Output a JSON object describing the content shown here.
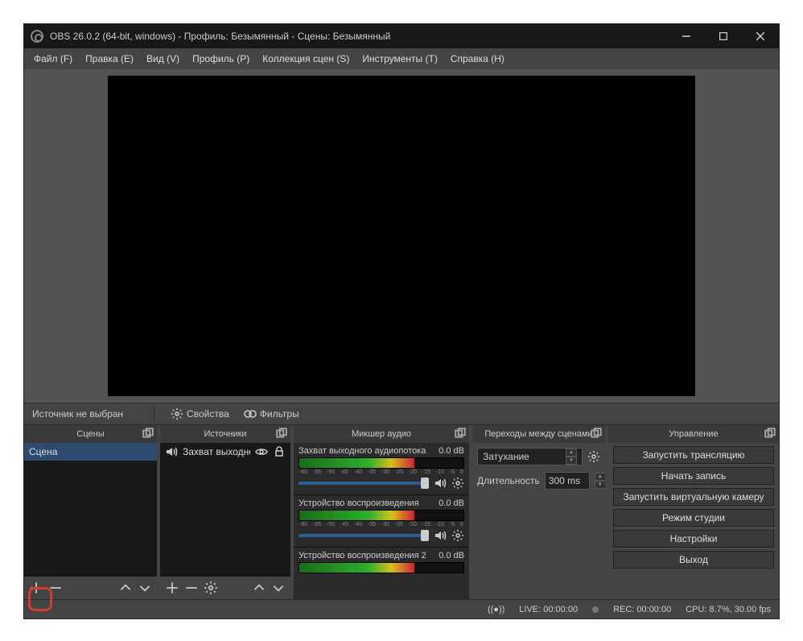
{
  "title": "OBS 26.0.2 (64-bit, windows) - Профиль: Безымянный - Сцены: Безымянный",
  "menu": [
    "Файл (F)",
    "Правка (E)",
    "Вид (V)",
    "Профиль (P)",
    "Коллекция сцен (S)",
    "Инструменты (T)",
    "Справка (H)"
  ],
  "infobar": {
    "no_source": "Источник не выбран",
    "properties": "Свойства",
    "filters": "Фильтры"
  },
  "docks": {
    "scenes": {
      "title": "Сцены",
      "items": [
        "Сцена"
      ]
    },
    "sources": {
      "title": "Источники",
      "items": [
        "Захват выходног"
      ]
    },
    "mixer": {
      "title": "Микшер аудио",
      "channels": [
        {
          "name": "Захват выходного аудиопотока",
          "db": "0.0 dB",
          "slider": 96
        },
        {
          "name": "Устройство воспроизведения",
          "db": "0.0 dB",
          "slider": 96
        },
        {
          "name": "Устройство воспроизведения 2",
          "db": "0.0 dB",
          "slider": 96
        }
      ],
      "ticks": [
        "-60",
        "-55",
        "-50",
        "-45",
        "-40",
        "-35",
        "-30",
        "-25",
        "-20",
        "-15",
        "-10",
        "-5",
        "0"
      ]
    },
    "transitions": {
      "title": "Переходы между сценами",
      "selected": "Затухание",
      "duration_label": "Длительность",
      "duration_value": "300 ms"
    },
    "controls": {
      "title": "Управление",
      "buttons": [
        "Запустить трансляцию",
        "Начать запись",
        "Запустить виртуальную камеру",
        "Режим студии",
        "Настройки",
        "Выход"
      ]
    }
  },
  "status": {
    "live": "LIVE: 00:00:00",
    "rec": "REC: 00:00:00",
    "cpu": "CPU: 8.7%, 30.00 fps"
  }
}
